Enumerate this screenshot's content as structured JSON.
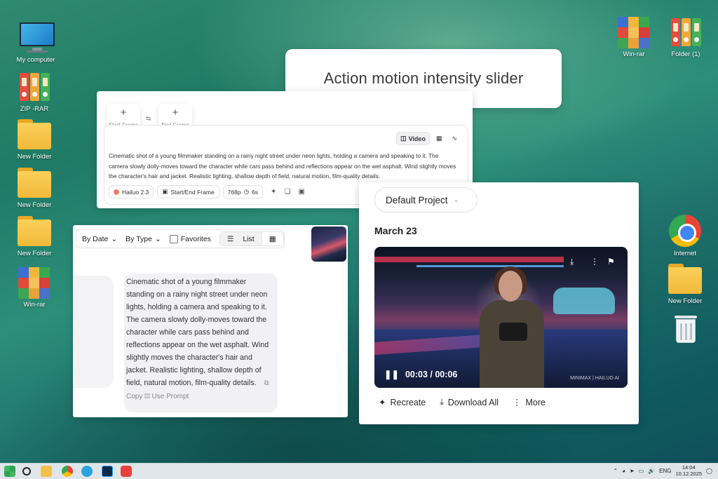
{
  "desktop": {
    "left_icons": [
      {
        "label": "My computer",
        "icon": "monitor-icon"
      },
      {
        "label": "ZIP -RAR",
        "icon": "binders-icon"
      },
      {
        "label": "New Folder",
        "icon": "folder-icon"
      },
      {
        "label": "New Folder",
        "icon": "folder-icon"
      },
      {
        "label": "New Folder",
        "icon": "folder-icon"
      },
      {
        "label": "Win-rar",
        "icon": "winrar-icon"
      }
    ],
    "right_icons": [
      {
        "label": "Win-rar",
        "icon": "winrar-icon"
      },
      {
        "label": "Folder (1)",
        "icon": "binders-icon"
      },
      {
        "label": "Internet",
        "icon": "chrome-icon"
      },
      {
        "label": "New Folder",
        "icon": "folder-icon"
      },
      {
        "label": "",
        "icon": "recycle-bin-icon"
      }
    ]
  },
  "callout": {
    "text": "Action motion intensity slider"
  },
  "composer": {
    "start_frame": {
      "plus": "+",
      "label": "Start Frame"
    },
    "end_frame": {
      "plus": "+",
      "label": "End Frame"
    },
    "swap_glyph": "⇆",
    "mode_tabs": [
      {
        "label": "Video",
        "icon": "video-icon",
        "active": true
      },
      {
        "label": "",
        "icon": "image-icon",
        "active": false
      },
      {
        "label": "",
        "icon": "audio-wave-icon",
        "active": false
      }
    ],
    "prompt": "Cinematic shot of a young filmmaker standing on a rainy night street under neon lights, holding a camera and speaking to it. The camera slowly dolly-moves toward the character while cars pass behind and reflections appear on the wet asphalt. Wind slightly moves the character's hair and jacket. Realistic lighting, shallow depth of field, natural motion, film-quality details.",
    "chips": {
      "model": "Hailuo 2.3",
      "mode": "Start/End Frame",
      "resolution": "768p",
      "duration": "6s"
    }
  },
  "history": {
    "filters": {
      "date": "By Date",
      "type": "By Type",
      "favorites": "Favorites",
      "list": "List"
    },
    "prompt": "Cinematic shot of a young filmmaker standing on a rainy night street under neon lights, holding a camera and speaking to it. The camera slowly dolly-moves toward the character while cars pass behind and reflections appear on the wet asphalt. Wind slightly moves the character's hair and jacket. Realistic lighting, shallow depth of field, natural motion, film-quality details.",
    "copy_label": "Copy",
    "use_prompt_label": "Use Prompt"
  },
  "video_panel": {
    "project": "Default Project",
    "date_heading": "March 23",
    "current_time": "00:03",
    "duration": "00:06",
    "watermark": "MINIMAX | HAILUO AI",
    "actions": {
      "recreate": "Recreate",
      "download_all": "Download All",
      "more": "More"
    }
  },
  "taskbar": {
    "lang": "ENG",
    "time": "14:04",
    "date": "10.12.2025"
  }
}
